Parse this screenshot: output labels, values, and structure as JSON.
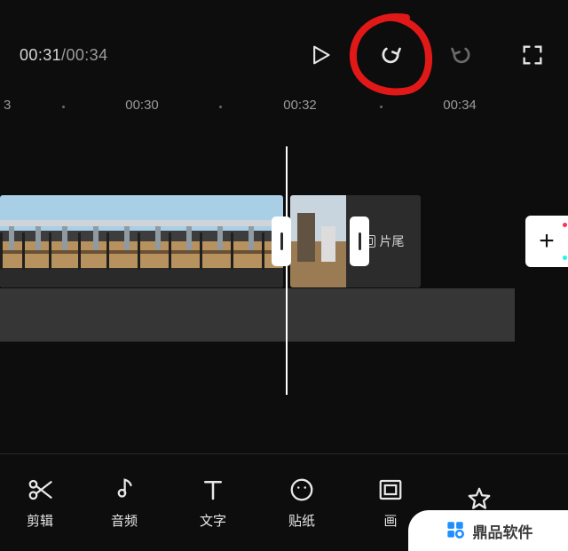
{
  "playback": {
    "current": "00:31",
    "total": "00:34",
    "separator": "/"
  },
  "ruler": {
    "edge_left": "3",
    "labels": [
      "00:30",
      "00:32",
      "00:34"
    ]
  },
  "clip_tail": {
    "label": "片尾"
  },
  "add_button": {
    "symbol": "+"
  },
  "tools": {
    "cut": {
      "label": "剪辑"
    },
    "audio": {
      "label": "音频"
    },
    "text": {
      "label": "文字"
    },
    "sticker": {
      "label": "贴纸"
    },
    "pip": {
      "label": "画"
    },
    "effect": {
      "label": ""
    }
  },
  "watermark": {
    "text": "鼎品软件"
  }
}
